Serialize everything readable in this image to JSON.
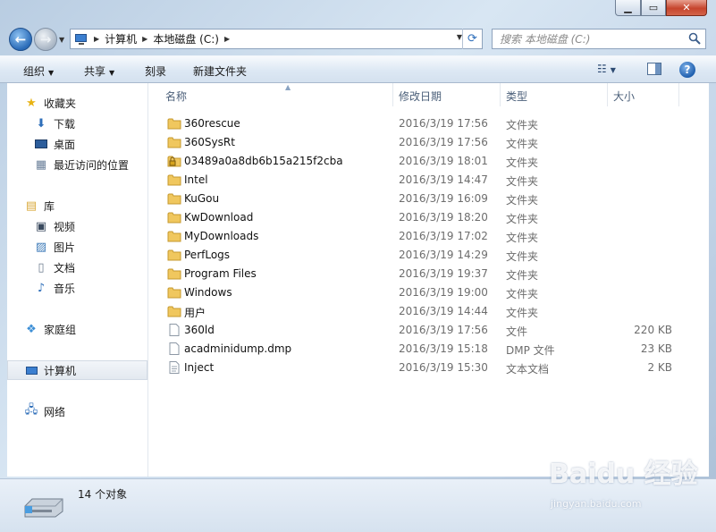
{
  "navigation": {
    "breadcrumb": [
      "计算机",
      "本地磁盘 (C:)"
    ]
  },
  "search": {
    "placeholder": "搜索 本地磁盘 (C:)"
  },
  "toolbar": {
    "organize_label": "组织",
    "share_label": "共享",
    "burn_label": "刻录",
    "new_folder_label": "新建文件夹"
  },
  "sidebar": {
    "favorites": {
      "label": "收藏夹",
      "items": [
        "下载",
        "桌面",
        "最近访问的位置"
      ]
    },
    "libraries": {
      "label": "库",
      "items": [
        "视频",
        "图片",
        "文档",
        "音乐"
      ]
    },
    "homegroup": "家庭组",
    "computer": "计算机",
    "network": "网络"
  },
  "columns": {
    "name": "名称",
    "date": "修改日期",
    "type": "类型",
    "size": "大小"
  },
  "files": [
    {
      "name": "360rescue",
      "date": "2016/3/19 17:56",
      "type": "文件夹",
      "size": "",
      "icon": "folder-icon"
    },
    {
      "name": "360SysRt",
      "date": "2016/3/19 17:56",
      "type": "文件夹",
      "size": "",
      "icon": "folder-icon"
    },
    {
      "name": "03489a0a8db6b15a215f2cba",
      "date": "2016/3/19 18:01",
      "type": "文件夹",
      "size": "",
      "icon": "locked-folder-icon"
    },
    {
      "name": "Intel",
      "date": "2016/3/19 14:47",
      "type": "文件夹",
      "size": "",
      "icon": "folder-icon"
    },
    {
      "name": "KuGou",
      "date": "2016/3/19 16:09",
      "type": "文件夹",
      "size": "",
      "icon": "folder-icon"
    },
    {
      "name": "KwDownload",
      "date": "2016/3/19 18:20",
      "type": "文件夹",
      "size": "",
      "icon": "folder-icon"
    },
    {
      "name": "MyDownloads",
      "date": "2016/3/19 17:02",
      "type": "文件夹",
      "size": "",
      "icon": "folder-icon"
    },
    {
      "name": "PerfLogs",
      "date": "2016/3/19 14:29",
      "type": "文件夹",
      "size": "",
      "icon": "folder-icon"
    },
    {
      "name": "Program Files",
      "date": "2016/3/19 19:37",
      "type": "文件夹",
      "size": "",
      "icon": "folder-icon"
    },
    {
      "name": "Windows",
      "date": "2016/3/19 19:00",
      "type": "文件夹",
      "size": "",
      "icon": "folder-icon"
    },
    {
      "name": "用户",
      "date": "2016/3/19 14:44",
      "type": "文件夹",
      "size": "",
      "icon": "folder-icon"
    },
    {
      "name": "360ld",
      "date": "2016/3/19 17:56",
      "type": "文件",
      "size": "220 KB",
      "icon": "file-icon"
    },
    {
      "name": "acadminidump.dmp",
      "date": "2016/3/19 15:18",
      "type": "DMP 文件",
      "size": "23 KB",
      "icon": "file-icon"
    },
    {
      "name": "Inject",
      "date": "2016/3/19 15:30",
      "type": "文本文档",
      "size": "2 KB",
      "icon": "text-file-icon"
    }
  ],
  "status": {
    "text": "14 个对象"
  },
  "watermark": {
    "logo": "Baidu 经验",
    "url": "jingyan.baidu.com"
  },
  "colors": {
    "folder": "#f0c75e",
    "accent": "#3b7fd0",
    "selected_nav": "#e3e9f0"
  }
}
